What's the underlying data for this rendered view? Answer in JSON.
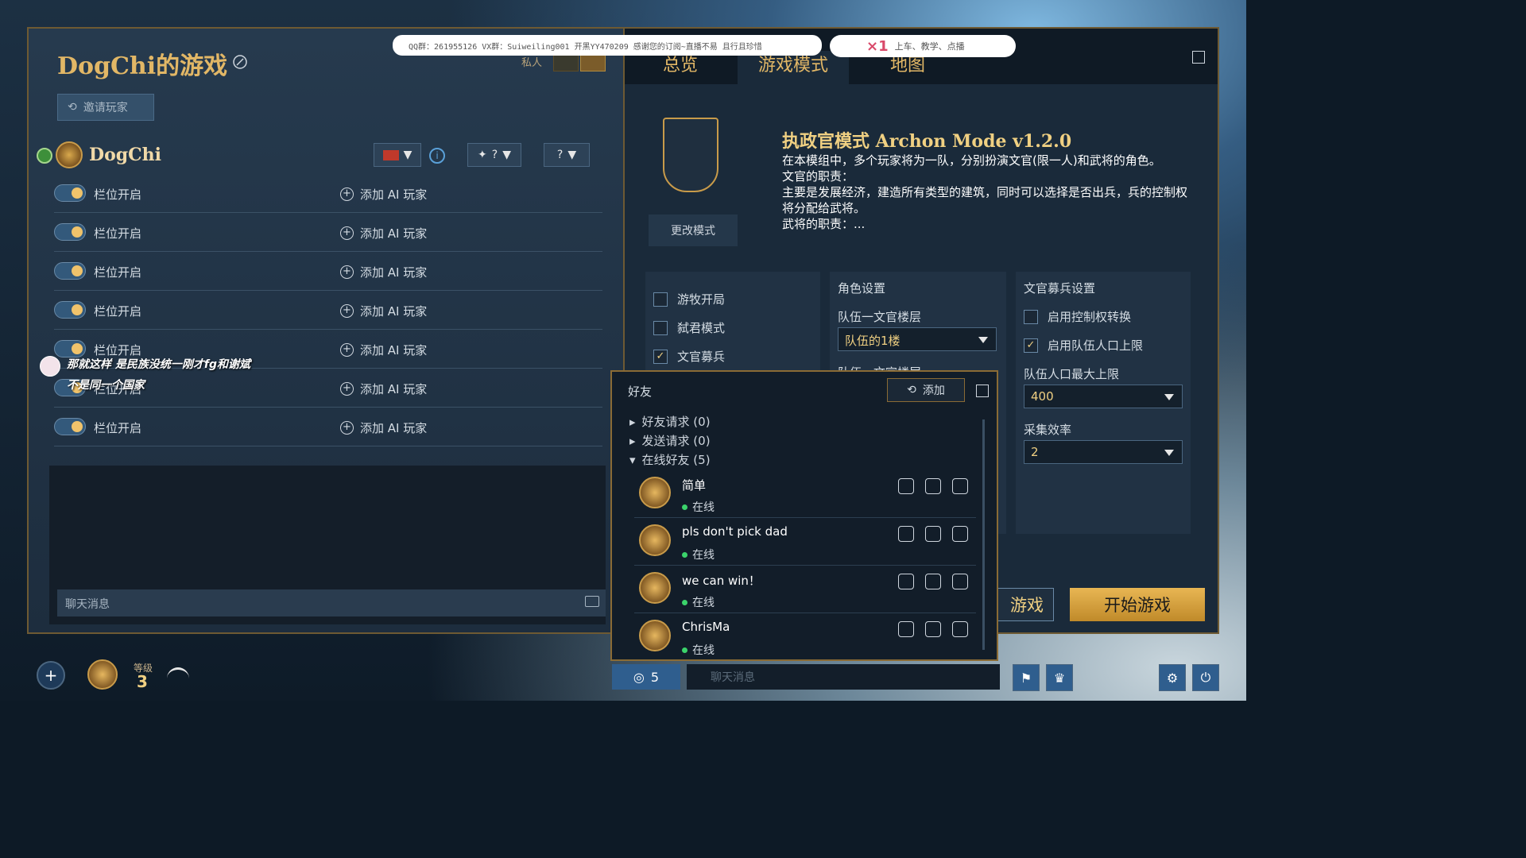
{
  "left_panel": {
    "game_title": "DogChi的游戏",
    "invite_label": "邀请玩家",
    "private_label": "私人",
    "host_name": "DogChi",
    "team_ctrl": "?",
    "slots": [
      {
        "label": "栏位开启",
        "add_ai": "添加 AI 玩家"
      },
      {
        "label": "栏位开启",
        "add_ai": "添加 AI 玩家"
      },
      {
        "label": "栏位开启",
        "add_ai": "添加 AI 玩家"
      },
      {
        "label": "栏位开启",
        "add_ai": "添加 AI 玩家"
      },
      {
        "label": "栏位开启",
        "add_ai": "添加 AI 玩家"
      },
      {
        "label": "栏位开启",
        "add_ai": "添加 AI 玩家"
      },
      {
        "label": "栏位开启",
        "add_ai": "添加 AI 玩家"
      }
    ],
    "chat_placeholder": "聊天消息"
  },
  "overlay": {
    "chat_line1": "那就这样     是民族没统一刚才fg和谢斌",
    "chat_line2": "不是同一个国家",
    "stream_text": "QQ群：261955126  VX群：Suiweiling001  开黑YY470209  感谢您的订阅~直播不易 且行且珍惜",
    "stream_counter": "×1",
    "stream_tags": "上车、教学、点播"
  },
  "tabs": {
    "overview": "总览",
    "game_mode": "游戏模式",
    "map": "地图"
  },
  "mode": {
    "change_btn": "更改模式",
    "title": "执政官模式 Archon Mode  v1.2.0",
    "desc_1": "在本模组中，多个玩家将为一队，分别扮演文官(限一人)和武将的角色。",
    "desc_2": "文官的职责：",
    "desc_3": "主要是发展经济，建造所有类型的建筑，同时可以选择是否出兵，兵的控制权将分配给武将。",
    "desc_4": "武将的职责：..."
  },
  "settings": {
    "col1": {
      "nomad": "游牧开局",
      "regicide": "弑君模式",
      "civil_recruit": "文官募兵"
    },
    "col2": {
      "title": "角色设置",
      "floor_label": "队伍一文官楼层",
      "floor_value": "队伍的1楼",
      "floor2_label": "队伍一文官楼层"
    },
    "col3": {
      "title": "文官募兵设置",
      "control_transfer": "启用控制权转换",
      "pop_limit_toggle": "启用队伍人口上限",
      "pop_max_label": "队伍人口最大上限",
      "pop_max_value": "400",
      "gather_label": "采集效率",
      "gather_value": "2"
    }
  },
  "buttons": {
    "leave_partial": "游戏",
    "start": "开始游戏"
  },
  "friends": {
    "title": "好友",
    "add_label": "添加",
    "requests": "好友请求 (0)",
    "sent": "发送请求 (0)",
    "online": "在线好友 (5)",
    "list": [
      {
        "name": "简单",
        "status": "在线"
      },
      {
        "name": "pls don't pick dad",
        "status": "在线"
      },
      {
        "name": "we can win！",
        "status": "在线"
      },
      {
        "name": "ChrisMa",
        "status": "在线"
      }
    ]
  },
  "bottom": {
    "level_label": "等级",
    "level_value": "3",
    "friends_count": "5",
    "chat_placeholder": "聊天消息"
  }
}
